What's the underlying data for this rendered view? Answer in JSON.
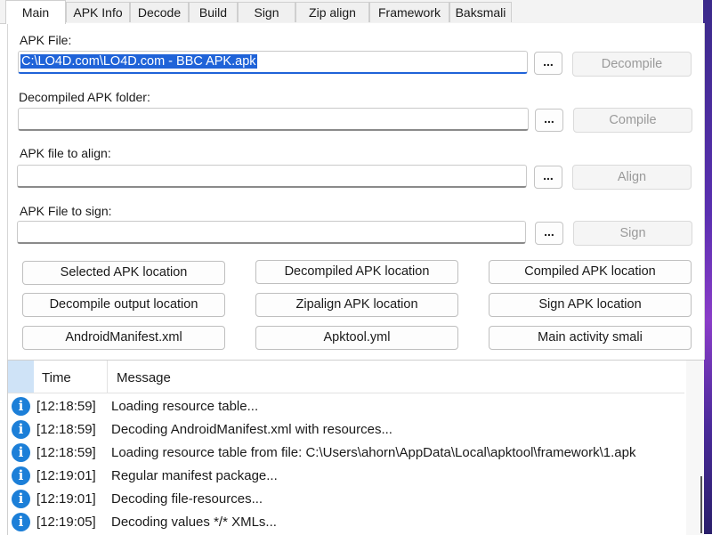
{
  "tabs": [
    {
      "label": "Main",
      "active": true
    },
    {
      "label": "APK Info"
    },
    {
      "label": "Decode"
    },
    {
      "label": "Build"
    },
    {
      "label": "Sign"
    },
    {
      "label": "Zip align"
    },
    {
      "label": "Framework"
    },
    {
      "label": "Baksmali"
    }
  ],
  "main": {
    "apk_file_label": "APK File:",
    "apk_file_value": "C:\\LO4D.com\\LO4D.com - BBC APK.apk",
    "decompile_label": "Decompile",
    "decompiled_folder_label": "Decompiled APK folder:",
    "compile_label": "Compile",
    "align_file_label": "APK file to align:",
    "align_label": "Align",
    "sign_file_label": "APK File to sign:",
    "sign_label": "Sign",
    "browse_label": "...",
    "location_buttons": [
      "Selected APK location",
      "Decompiled APK location",
      "Compiled APK location",
      "Decompile output location",
      "Zipalign APK location",
      "Sign APK location",
      "AndroidManifest.xml",
      "Apktool.yml",
      "Main activity smali"
    ]
  },
  "log": {
    "col_time": "Time",
    "col_message": "Message",
    "icon": "info-icon",
    "rows": [
      {
        "time": "[12:18:59]",
        "message": "Loading resource table..."
      },
      {
        "time": "[12:18:59]",
        "message": "Decoding AndroidManifest.xml with resources..."
      },
      {
        "time": "[12:18:59]",
        "message": "Loading resource table from file: C:\\Users\\ahorn\\AppData\\Local\\apktool\\framework\\1.apk"
      },
      {
        "time": "[12:19:01]",
        "message": "Regular manifest package..."
      },
      {
        "time": "[12:19:01]",
        "message": "Decoding file-resources..."
      },
      {
        "time": "[12:19:05]",
        "message": "Decoding values */* XMLs..."
      }
    ]
  },
  "colors": {
    "accent": "#1f63d8",
    "info": "#1c7fd8",
    "disabled_text": "#9a9a9a"
  }
}
